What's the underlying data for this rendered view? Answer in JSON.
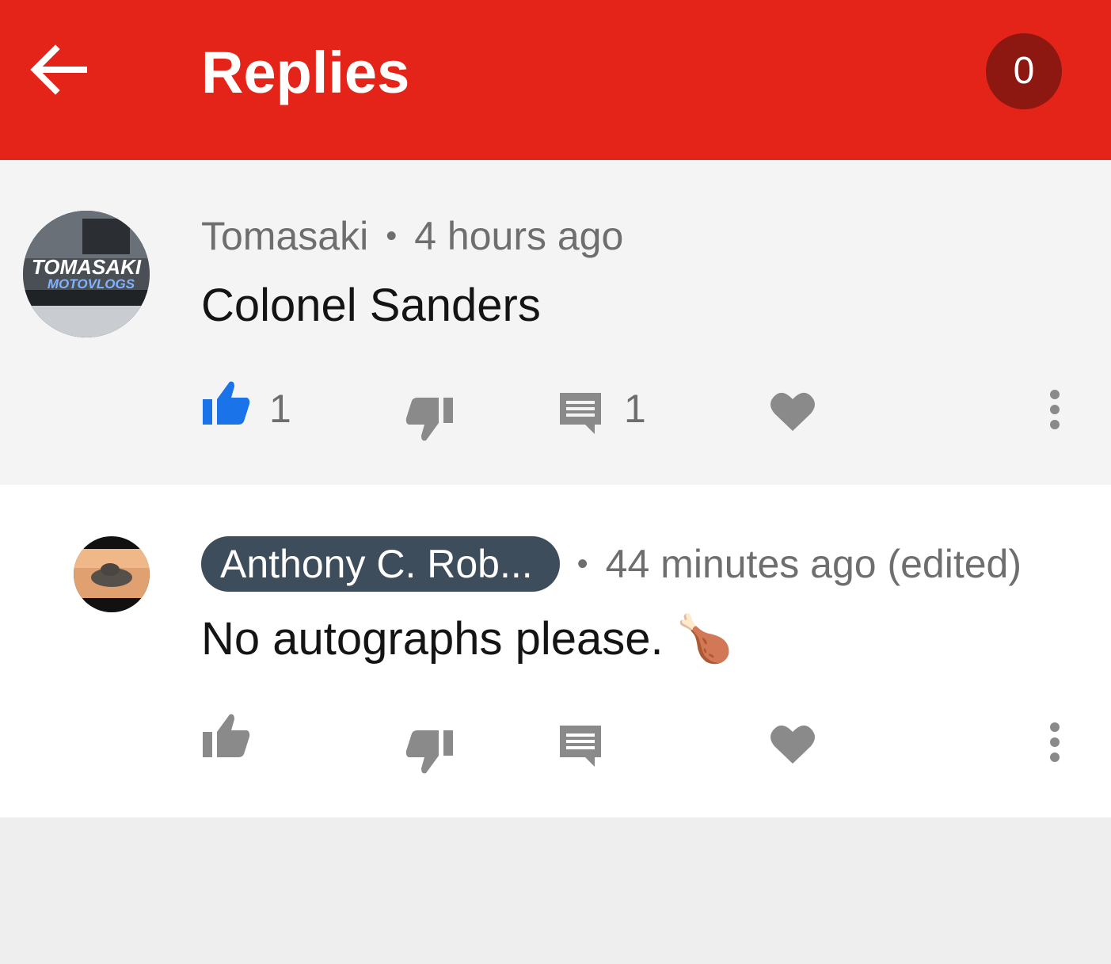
{
  "header": {
    "title": "Replies",
    "badge_count": "0",
    "accent_color": "#e52419"
  },
  "comments": [
    {
      "author": "Tomasaki",
      "separator": "•",
      "timestamp": "4 hours ago",
      "text": "Colonel Sanders",
      "avatar_text_top": "TOMASAKI",
      "avatar_text_bottom": "MOTOVLOGS",
      "like_count": "1",
      "reply_count": "1",
      "liked": true
    },
    {
      "author": "Anthony C. Rob...",
      "separator": "•",
      "timestamp": "44 minutes ago (edited)",
      "text": "No autographs please.",
      "emoji": "🍗",
      "liked": false
    }
  ],
  "icons": {
    "back": "arrow-left-icon",
    "like": "thumb-up-icon",
    "dislike": "thumb-down-icon",
    "reply": "comment-icon",
    "heart": "heart-icon",
    "more": "more-vert-icon"
  },
  "colors": {
    "liked": "#1a73e8",
    "icon": "#8a8a8a",
    "chip": "#3e4d5b"
  }
}
